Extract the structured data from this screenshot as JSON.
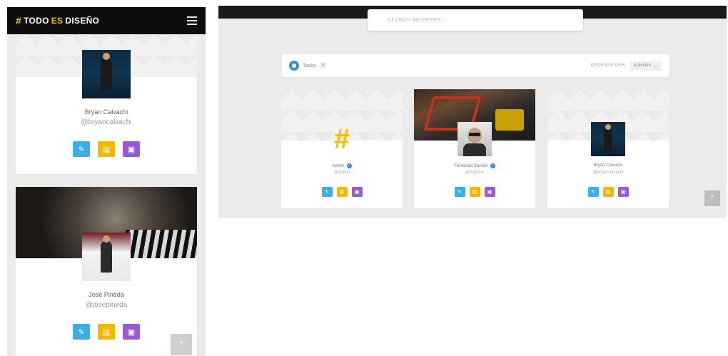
{
  "brand": {
    "logo_left": "TODO",
    "logo_es": "ES",
    "logo_right": "DISEÑO",
    "hash": "#"
  },
  "colors": {
    "accent_blue": "#3aaee6",
    "accent_yellow": "#f5b800",
    "accent_purple": "#9b59d6",
    "verified": "#3a8ad6",
    "logo_yellow": "#f2c200"
  },
  "icons": {
    "menu": "hamburger-icon",
    "edit": "pencil-icon",
    "message": "chat-icon",
    "profile": "card-icon",
    "scroll_top": "chevron-up-icon"
  },
  "mobile": {
    "cards": [
      {
        "name": "Bryan Calvachi",
        "handle": "@bryancalvachi"
      },
      {
        "name": "José Pineda",
        "handle": "@josepineda"
      }
    ],
    "scroll_top": "⌃"
  },
  "desktop": {
    "search": {
      "placeholder": "SEARCH MEMBERS..."
    },
    "filter": {
      "label": "Todos",
      "count": "3",
      "sort_label": "ORDENAR POR",
      "sort_value": "Actividad"
    },
    "cards": [
      {
        "name": "Admin",
        "handle": "@admin"
      },
      {
        "name": "Fernanda Carrión",
        "handle": "@fcarrion"
      },
      {
        "name": "Bryan Calvachi",
        "handle": "@bryancalvachi"
      }
    ],
    "scroll_top": "⌃"
  }
}
